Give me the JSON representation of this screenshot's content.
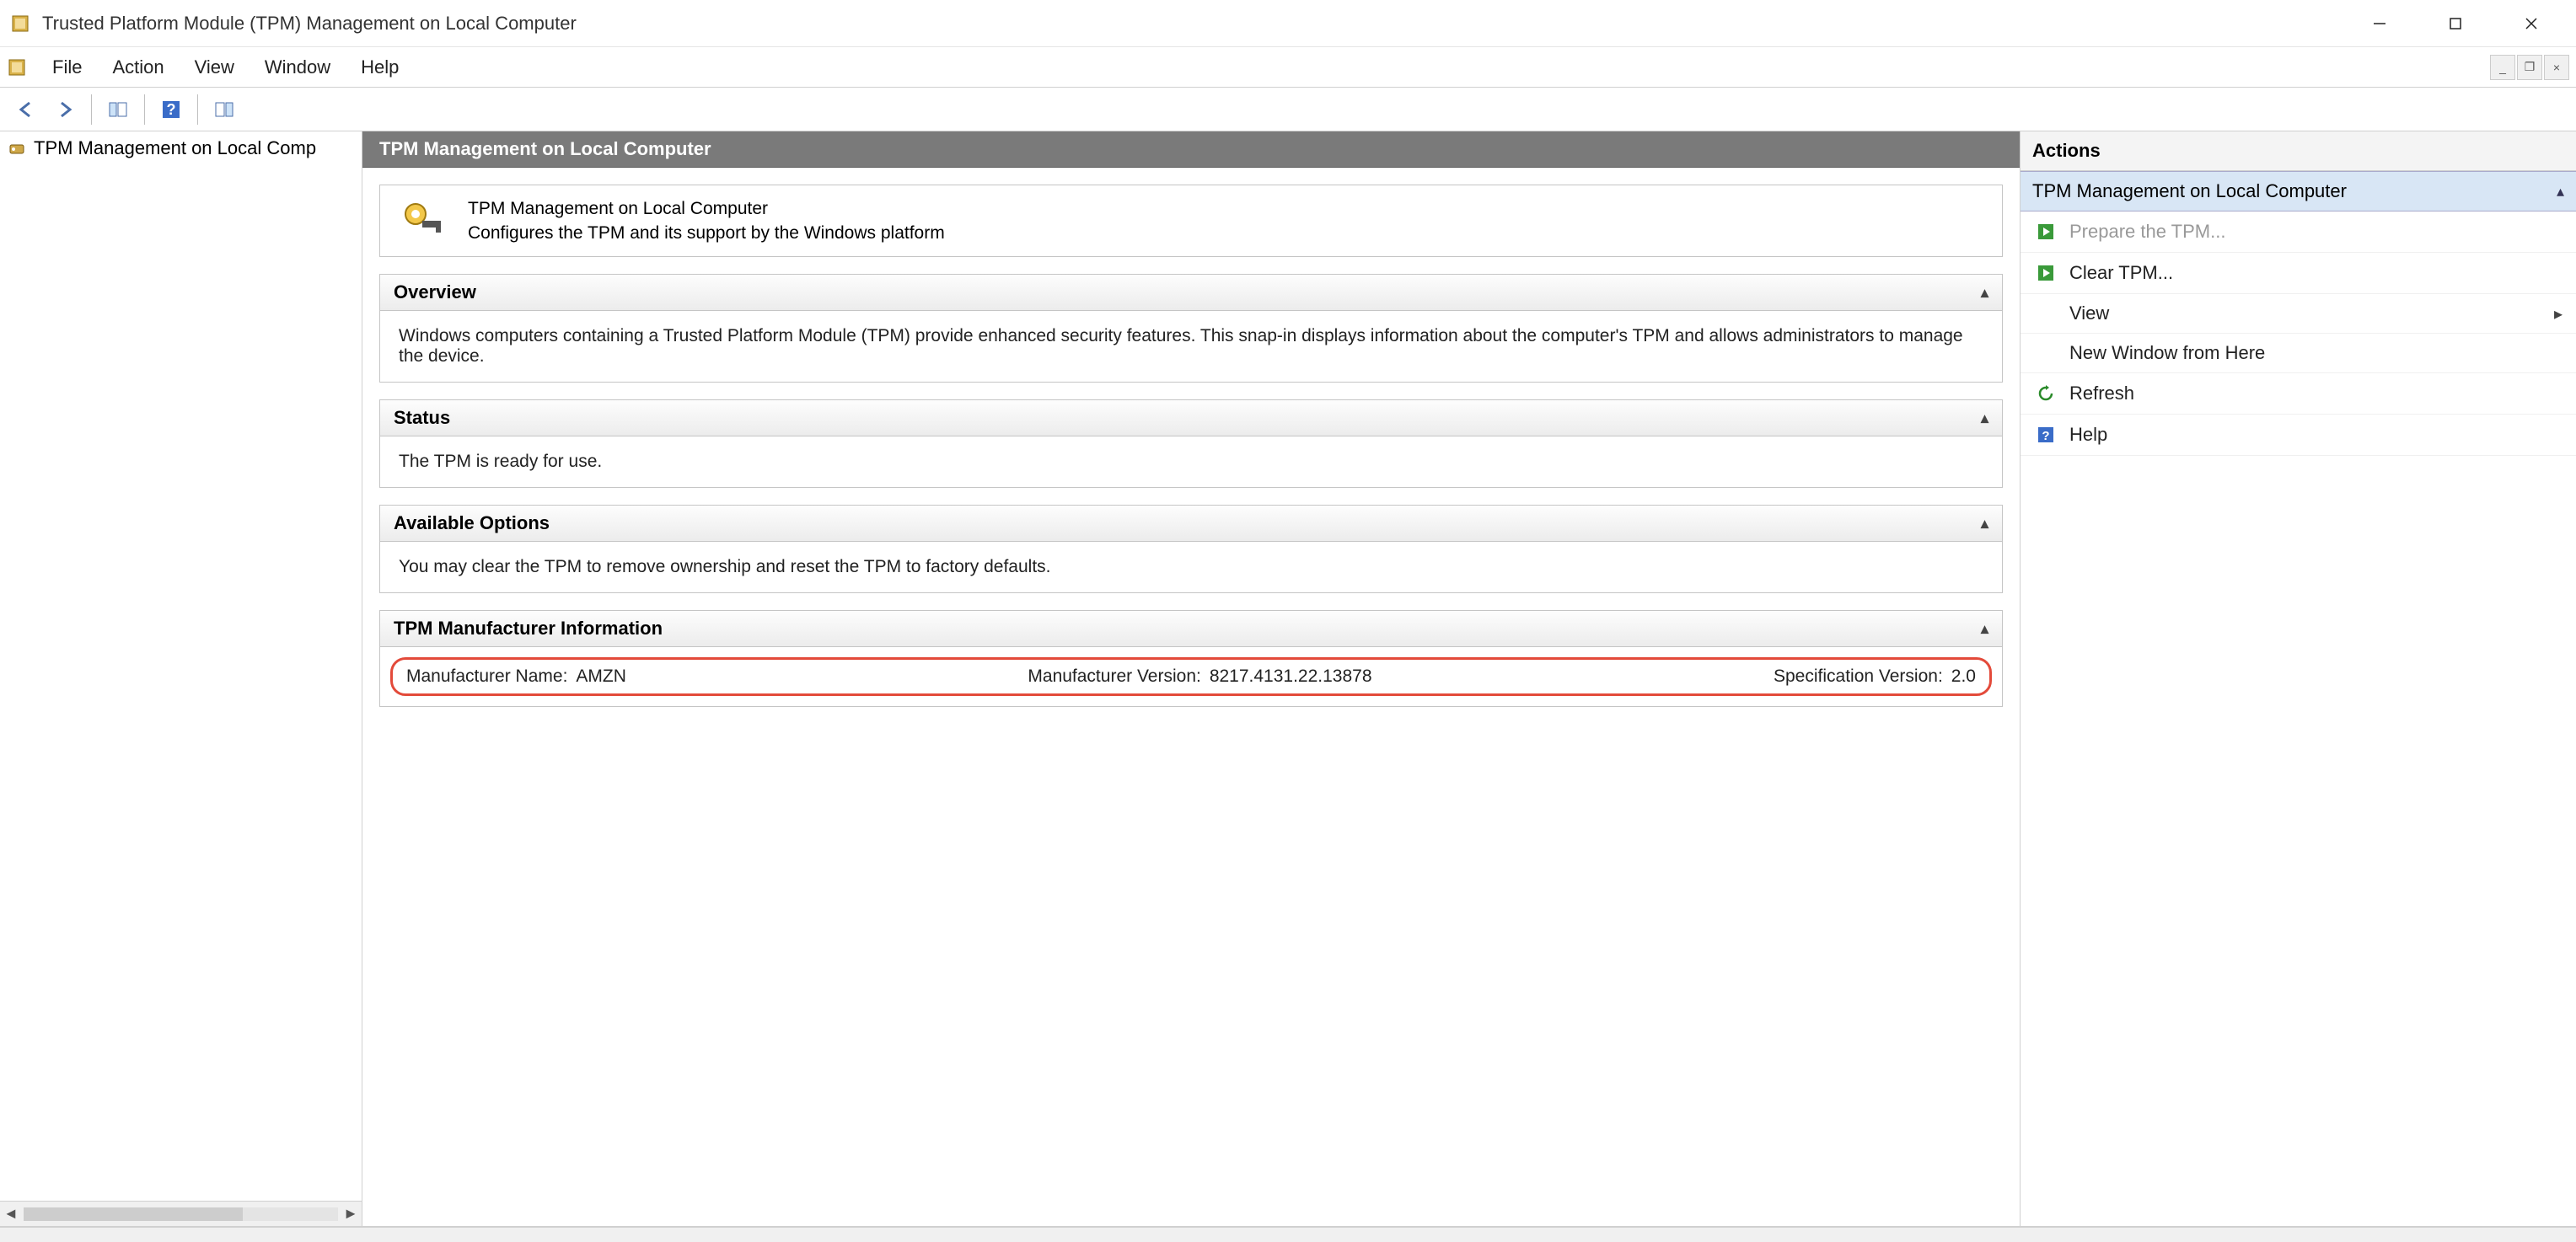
{
  "window": {
    "title": "Trusted Platform Module (TPM) Management on Local Computer"
  },
  "menu": {
    "file": "File",
    "action": "Action",
    "view": "View",
    "window": "Window",
    "help": "Help"
  },
  "tree": {
    "root": "TPM Management on Local Comp"
  },
  "content": {
    "header": "TPM Management on Local Computer",
    "desc_title": "TPM Management on Local Computer",
    "desc_sub": "Configures the TPM and its support by the Windows platform",
    "overview": {
      "title": "Overview",
      "body": "Windows computers containing a Trusted Platform Module (TPM) provide enhanced security features. This snap-in displays information about the computer's TPM and allows administrators to manage the device."
    },
    "status": {
      "title": "Status",
      "body": "The TPM is ready for use."
    },
    "options": {
      "title": "Available Options",
      "body": "You may clear the TPM to remove ownership and reset the TPM to factory defaults."
    },
    "mfr": {
      "title": "TPM Manufacturer Information",
      "name_label": "Manufacturer Name:",
      "name_value": "AMZN",
      "ver_label": "Manufacturer Version:",
      "ver_value": "8217.4131.22.13878",
      "spec_label": "Specification Version:",
      "spec_value": "2.0"
    }
  },
  "actions": {
    "title": "Actions",
    "group": "TPM Management on Local Computer",
    "prepare": "Prepare the TPM...",
    "clear": "Clear TPM...",
    "view": "View",
    "newwin": "New Window from Here",
    "refresh": "Refresh",
    "help": "Help"
  }
}
